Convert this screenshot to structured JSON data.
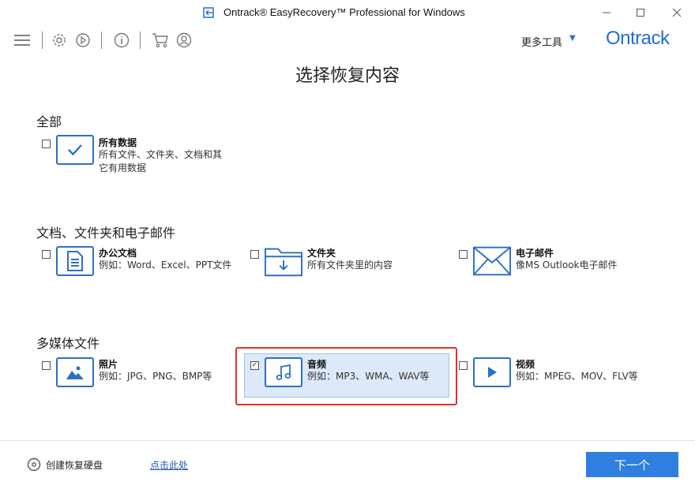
{
  "window": {
    "title": "Ontrack® EasyRecovery™ Professional for Windows",
    "controls": [
      "minimize",
      "maximize",
      "close"
    ]
  },
  "toolbar": {
    "icons": [
      "menu-icon",
      "gear-icon",
      "recover-icon",
      "info-icon",
      "cart-icon",
      "account-icon"
    ],
    "more_tools": "更多工具",
    "logo": "Ontrack"
  },
  "page": {
    "title": "选择恢复内容"
  },
  "sections": [
    {
      "title": "全部",
      "items": [
        {
          "label": "所有数据",
          "desc_lines": [
            "所有文件、文件夹、文档和其",
            "它有用数据"
          ],
          "icon": "checkmark-icon",
          "checked": false
        }
      ]
    },
    {
      "title": "文档、文件夹和电子邮件",
      "items": [
        {
          "label": "办公文档",
          "desc_lines": [
            "例如：Word、Excel、PPT文件"
          ],
          "icon": "document-icon",
          "checked": false
        },
        {
          "label": "文件夹",
          "desc_lines": [
            "所有文件夹里的内容"
          ],
          "icon": "folder-icon",
          "checked": false
        },
        {
          "label": "电子邮件",
          "desc_lines": [
            "像MS Outlook电子邮件"
          ],
          "icon": "envelope-icon",
          "checked": false
        }
      ]
    },
    {
      "title": "多媒体文件",
      "items": [
        {
          "label": "照片",
          "desc_lines": [
            "例如：JPG、PNG、BMP等"
          ],
          "icon": "image-icon",
          "checked": false
        },
        {
          "label": "音频",
          "desc_lines": [
            "例如：MP3、WMA、WAV等"
          ],
          "icon": "music-note-icon",
          "checked": true
        },
        {
          "label": "视频",
          "desc_lines": [
            "例如：MPEG、MOV、FLV等"
          ],
          "icon": "play-icon",
          "checked": false
        }
      ]
    }
  ],
  "footer": {
    "create_disk_label": "创建恢复硬盘",
    "link_text": "点击此处",
    "next_label": "下一个"
  },
  "colors": {
    "accent": "#2c6fc7",
    "button": "#2e7fe0",
    "highlight": "#e0312b",
    "selected_bg": "#dce9f9"
  }
}
